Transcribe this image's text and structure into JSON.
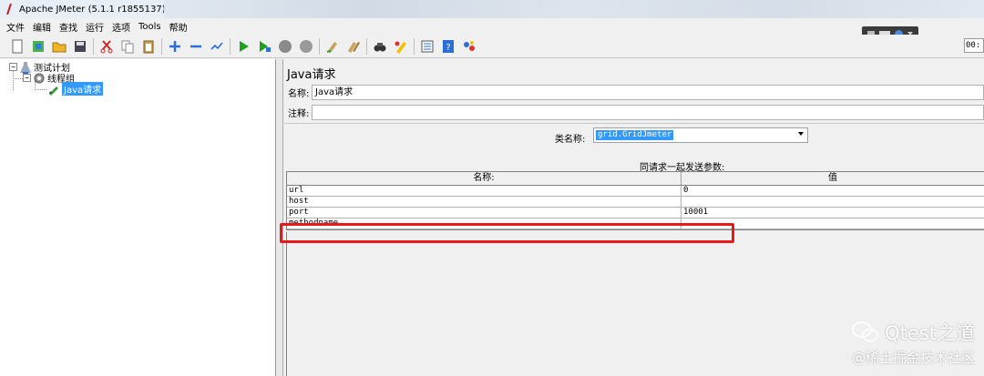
{
  "window": {
    "title": "Apache JMeter (5.1.1 r1855137)"
  },
  "menu": [
    {
      "label": "文件"
    },
    {
      "label": "编辑"
    },
    {
      "label": "查找"
    },
    {
      "label": "运行"
    },
    {
      "label": "选项"
    },
    {
      "label": "Tools"
    },
    {
      "label": "帮助"
    }
  ],
  "toolbar": {
    "icons": [
      "new-icon",
      "templates-icon",
      "open-icon",
      "save-icon",
      "cut-icon",
      "copy-icon",
      "paste-icon",
      "expand-icon",
      "collapse-icon",
      "toggle-icon",
      "start-icon",
      "start-no-pause-icon",
      "stop-icon",
      "shutdown-icon",
      "clear-icon",
      "clear-all-icon",
      "search-icon",
      "reset-search-icon",
      "function-helper-icon",
      "help-icon",
      "remote-icon"
    ],
    "timer": "00:"
  },
  "tree": {
    "items": [
      {
        "label": "测试计划",
        "toggle": "−"
      },
      {
        "label": "线程组",
        "toggle": "−"
      },
      {
        "label": "Java请求",
        "selected": true
      }
    ]
  },
  "panel": {
    "title": "Java请求",
    "name_label": "名称:",
    "name_value": "Java请求",
    "comment_label": "注释:",
    "comment_value": "",
    "classname_label": "类名称:",
    "classname_value": "grid.GridJmeter",
    "params_caption": "同请求一起发送参数:",
    "columns": [
      "名称:",
      "值"
    ],
    "rows": [
      {
        "name": "url",
        "value": "0"
      },
      {
        "name": "host",
        "value": ""
      },
      {
        "name": "port",
        "value": "10001"
      },
      {
        "name": "methodname",
        "value": ""
      }
    ]
  },
  "watermark": {
    "brand": "Qtest之道",
    "sub": "@稀土掘金技术社区"
  },
  "colors": {
    "highlight": "#e8191b",
    "selection": "#3399ff"
  }
}
